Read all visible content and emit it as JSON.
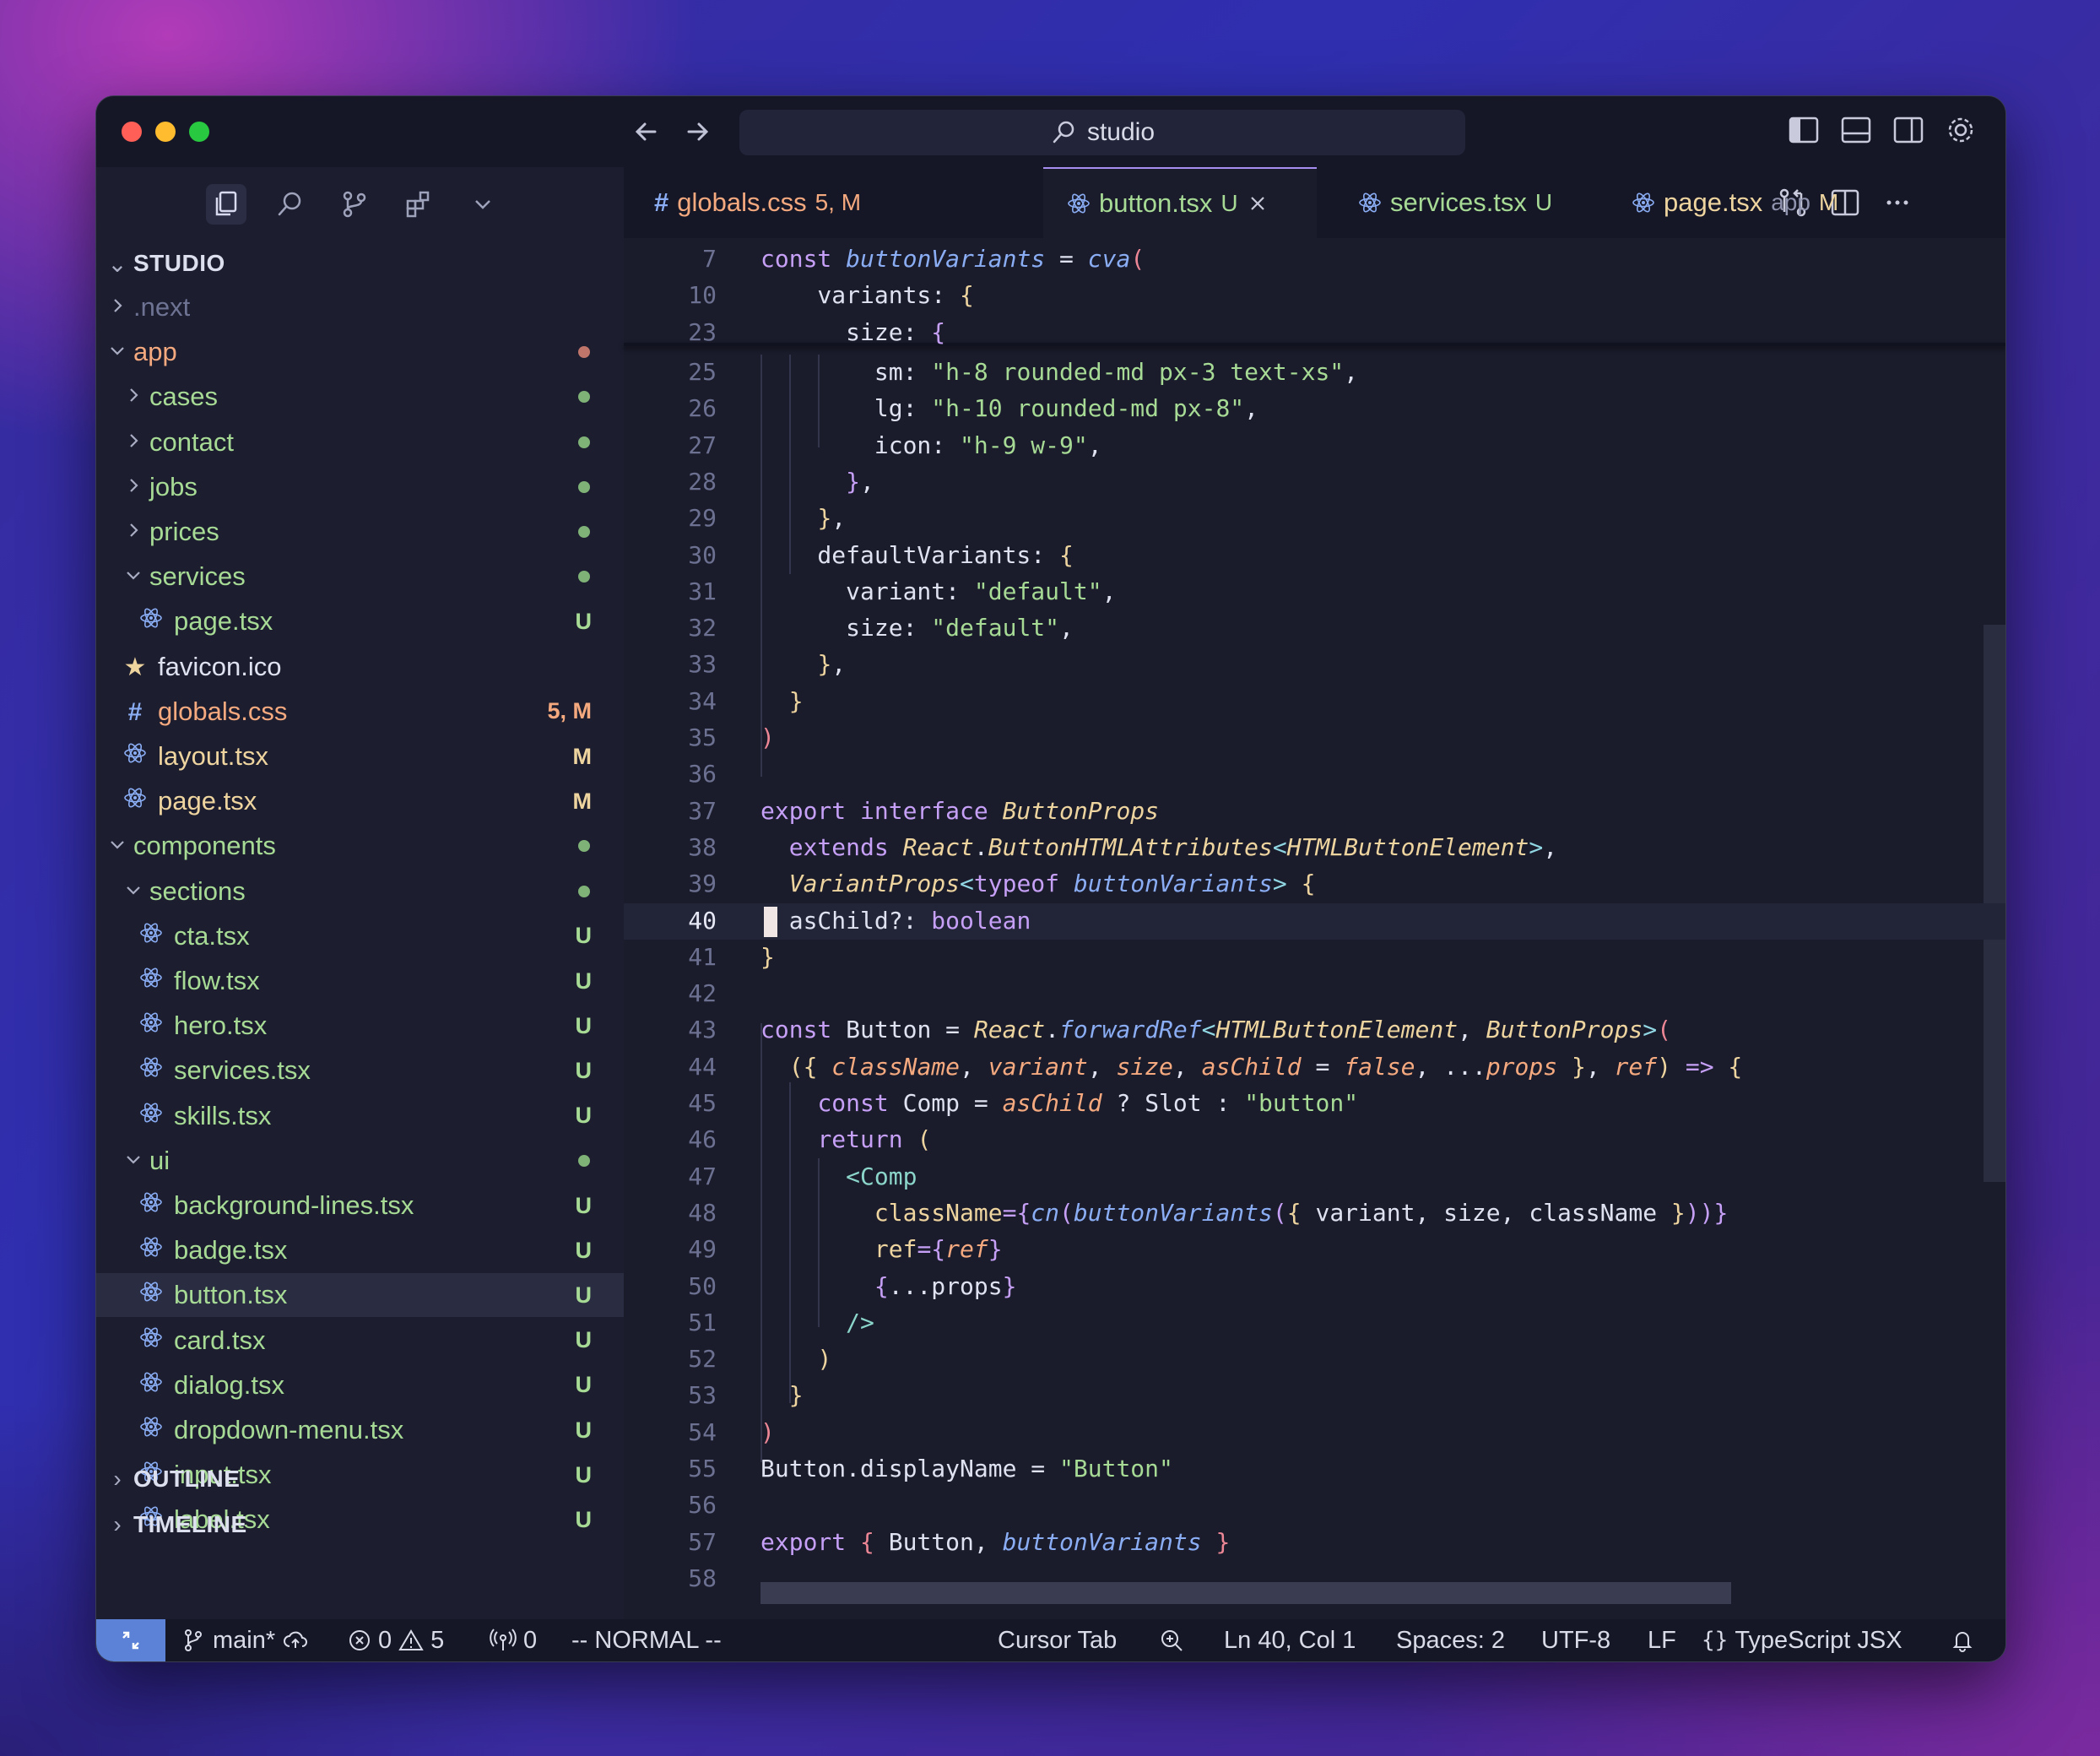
{
  "window": {
    "search": "studio"
  },
  "tabs": [
    {
      "icon": "#",
      "name": "globals.css",
      "status": "5, M",
      "color": "#f5a97f",
      "status_color": "#f5a97f",
      "active": false
    },
    {
      "icon": "react",
      "name": "button.tsx",
      "status": "U",
      "color": "#a6da95",
      "status_color": "#a6da95",
      "active": true
    },
    {
      "icon": "react",
      "name": "services.tsx",
      "status": "U",
      "color": "#a6da95",
      "status_color": "#a6da95",
      "active": false
    },
    {
      "icon": "react",
      "name": "page.tsx",
      "extra": "app",
      "status": "M",
      "color": "#eed49f",
      "status_color": "#eed49f",
      "active": false
    }
  ],
  "explorer": {
    "title": "STUDIO",
    "items": [
      {
        "name": ".next",
        "type": "folder",
        "open": false,
        "depth": 1,
        "color": "#6e7393"
      },
      {
        "name": "app",
        "type": "folder",
        "open": true,
        "depth": 1,
        "color": "#f5a97f",
        "dot": "#c0756a"
      },
      {
        "name": "cases",
        "type": "folder",
        "open": false,
        "depth": 2,
        "color": "#a6da95",
        "dot": "#7fb277"
      },
      {
        "name": "contact",
        "type": "folder",
        "open": false,
        "depth": 2,
        "color": "#a6da95",
        "dot": "#7fb277"
      },
      {
        "name": "jobs",
        "type": "folder",
        "open": false,
        "depth": 2,
        "color": "#a6da95",
        "dot": "#7fb277"
      },
      {
        "name": "prices",
        "type": "folder",
        "open": false,
        "depth": 2,
        "color": "#a6da95",
        "dot": "#7fb277"
      },
      {
        "name": "services",
        "type": "folder",
        "open": true,
        "depth": 2,
        "color": "#a6da95",
        "dot": "#7fb277"
      },
      {
        "name": "page.tsx",
        "type": "react",
        "depth": 3,
        "color": "#a6da95",
        "badge": "U"
      },
      {
        "name": "favicon.ico",
        "type": "star",
        "depth": 2,
        "color": "#dfe2f1"
      },
      {
        "name": "globals.css",
        "type": "hash",
        "depth": 2,
        "color": "#f5a97f",
        "badge": "5, M",
        "badge_color": "#f5a97f"
      },
      {
        "name": "layout.tsx",
        "type": "react",
        "depth": 2,
        "color": "#eed49f",
        "badge": "M",
        "badge_color": "#eed49f"
      },
      {
        "name": "page.tsx",
        "type": "react",
        "depth": 2,
        "color": "#eed49f",
        "badge": "M",
        "badge_color": "#eed49f"
      },
      {
        "name": "components",
        "type": "folder",
        "open": true,
        "depth": 1,
        "color": "#a6da95",
        "dot": "#7fb277"
      },
      {
        "name": "sections",
        "type": "folder",
        "open": true,
        "depth": 2,
        "color": "#a6da95",
        "dot": "#7fb277"
      },
      {
        "name": "cta.tsx",
        "type": "react",
        "depth": 3,
        "color": "#a6da95",
        "badge": "U"
      },
      {
        "name": "flow.tsx",
        "type": "react",
        "depth": 3,
        "color": "#a6da95",
        "badge": "U"
      },
      {
        "name": "hero.tsx",
        "type": "react",
        "depth": 3,
        "color": "#a6da95",
        "badge": "U"
      },
      {
        "name": "services.tsx",
        "type": "react",
        "depth": 3,
        "color": "#a6da95",
        "badge": "U"
      },
      {
        "name": "skills.tsx",
        "type": "react",
        "depth": 3,
        "color": "#a6da95",
        "badge": "U"
      },
      {
        "name": "ui",
        "type": "folder",
        "open": true,
        "depth": 2,
        "color": "#a6da95",
        "dot": "#7fb277"
      },
      {
        "name": "background-lines.tsx",
        "type": "react",
        "depth": 3,
        "color": "#a6da95",
        "badge": "U"
      },
      {
        "name": "badge.tsx",
        "type": "react",
        "depth": 3,
        "color": "#a6da95",
        "badge": "U"
      },
      {
        "name": "button.tsx",
        "type": "react",
        "depth": 3,
        "color": "#a6da95",
        "badge": "U",
        "selected": true
      },
      {
        "name": "card.tsx",
        "type": "react",
        "depth": 3,
        "color": "#a6da95",
        "badge": "U"
      },
      {
        "name": "dialog.tsx",
        "type": "react",
        "depth": 3,
        "color": "#a6da95",
        "badge": "U"
      },
      {
        "name": "dropdown-menu.tsx",
        "type": "react",
        "depth": 3,
        "color": "#a6da95",
        "badge": "U"
      },
      {
        "name": "input.tsx",
        "type": "react",
        "depth": 3,
        "color": "#a6da95",
        "badge": "U"
      },
      {
        "name": "label.tsx",
        "type": "react",
        "depth": 3,
        "color": "#a6da95",
        "badge": "U"
      }
    ],
    "outline": "OUTLINE",
    "timeline": "TIMELINE"
  },
  "editor": {
    "current_line": 40,
    "lines": [
      {
        "n": "7",
        "sticky": true,
        "tokens": [
          [
            "k",
            "const "
          ],
          [
            "f",
            "buttonVariants"
          ],
          [
            "p",
            " = "
          ],
          [
            "f",
            "cva"
          ],
          [
            "br1",
            "("
          ]
        ]
      },
      {
        "n": "10",
        "sticky": true,
        "tokens": [
          [
            "p",
            "    variants: "
          ],
          [
            "br2",
            "{"
          ]
        ]
      },
      {
        "n": "23",
        "sticky": true,
        "tokens": [
          [
            "p",
            "      size: "
          ],
          [
            "k",
            "{"
          ]
        ]
      },
      {
        "n": "25",
        "tokens": [
          [
            "p",
            "        sm: "
          ],
          [
            "s",
            "\"h-8 rounded-md px-3 text-xs\""
          ],
          [
            "p",
            ","
          ]
        ]
      },
      {
        "n": "26",
        "tokens": [
          [
            "p",
            "        lg: "
          ],
          [
            "s",
            "\"h-10 rounded-md px-8\""
          ],
          [
            "p",
            ","
          ]
        ]
      },
      {
        "n": "27",
        "tokens": [
          [
            "p",
            "        icon: "
          ],
          [
            "s",
            "\"h-9 w-9\""
          ],
          [
            "p",
            ","
          ]
        ]
      },
      {
        "n": "28",
        "tokens": [
          [
            "p",
            "      "
          ],
          [
            "k",
            "}"
          ],
          [
            "p",
            ","
          ]
        ]
      },
      {
        "n": "29",
        "tokens": [
          [
            "p",
            "    "
          ],
          [
            "br2",
            "}"
          ],
          [
            "p",
            ","
          ]
        ]
      },
      {
        "n": "30",
        "tokens": [
          [
            "p",
            "    defaultVariants: "
          ],
          [
            "br2",
            "{"
          ]
        ]
      },
      {
        "n": "31",
        "tokens": [
          [
            "p",
            "      variant: "
          ],
          [
            "s",
            "\"default\""
          ],
          [
            "p",
            ","
          ]
        ]
      },
      {
        "n": "32",
        "tokens": [
          [
            "p",
            "      size: "
          ],
          [
            "s",
            "\"default\""
          ],
          [
            "p",
            ","
          ]
        ]
      },
      {
        "n": "33",
        "tokens": [
          [
            "p",
            "    "
          ],
          [
            "br2",
            "}"
          ],
          [
            "p",
            ","
          ]
        ]
      },
      {
        "n": "34",
        "tokens": [
          [
            "p",
            "  "
          ],
          [
            "br2",
            "}"
          ]
        ]
      },
      {
        "n": "35",
        "tokens": [
          [
            "br1",
            ")"
          ]
        ]
      },
      {
        "n": "36",
        "tokens": []
      },
      {
        "n": "37",
        "tokens": [
          [
            "k",
            "export interface "
          ],
          [
            "t",
            "ButtonProps"
          ]
        ]
      },
      {
        "n": "38",
        "tokens": [
          [
            "p",
            "  "
          ],
          [
            "k",
            "extends "
          ],
          [
            "t",
            "React"
          ],
          [
            "p",
            "."
          ],
          [
            "t",
            "ButtonHTMLAttributes"
          ],
          [
            "o",
            "<"
          ],
          [
            "t",
            "HTMLButtonElement"
          ],
          [
            "o",
            ">"
          ],
          [
            "p",
            ","
          ]
        ]
      },
      {
        "n": "39",
        "tokens": [
          [
            "p",
            "  "
          ],
          [
            "t",
            "VariantProps"
          ],
          [
            "o",
            "<"
          ],
          [
            "k",
            "typeof "
          ],
          [
            "f",
            "buttonVariants"
          ],
          [
            "o",
            "> "
          ],
          [
            "br2",
            "{"
          ]
        ]
      },
      {
        "n": "40",
        "tokens": [
          [
            "p",
            "  asChild?: "
          ],
          [
            "k",
            "boolean"
          ]
        ]
      },
      {
        "n": "41",
        "tokens": [
          [
            "br2",
            "}"
          ]
        ]
      },
      {
        "n": "42",
        "tokens": []
      },
      {
        "n": "43",
        "tokens": [
          [
            "k",
            "const "
          ],
          [
            "p",
            "Button = "
          ],
          [
            "t",
            "React"
          ],
          [
            "p",
            "."
          ],
          [
            "f",
            "forwardRef"
          ],
          [
            "o",
            "<"
          ],
          [
            "t",
            "HTMLButtonElement"
          ],
          [
            "p",
            ", "
          ],
          [
            "t",
            "ButtonProps"
          ],
          [
            "o",
            ">"
          ],
          [
            "br1",
            "("
          ]
        ]
      },
      {
        "n": "44",
        "tokens": [
          [
            "p",
            "  "
          ],
          [
            "br2",
            "("
          ],
          [
            "br2",
            "{ "
          ],
          [
            "pi",
            "className"
          ],
          [
            "p",
            ", "
          ],
          [
            "pi",
            "variant"
          ],
          [
            "p",
            ", "
          ],
          [
            "pi",
            "size"
          ],
          [
            "p",
            ", "
          ],
          [
            "pi",
            "asChild"
          ],
          [
            "p",
            " = "
          ],
          [
            "pi",
            "false"
          ],
          [
            "p",
            ", ..."
          ],
          [
            "pi",
            "props"
          ],
          [
            "p",
            " "
          ],
          [
            "br2",
            "}"
          ],
          [
            "p",
            ", "
          ],
          [
            "pi",
            "ref"
          ],
          [
            "br2",
            ")"
          ],
          [
            "k",
            " => "
          ],
          [
            "br2",
            "{"
          ]
        ]
      },
      {
        "n": "45",
        "tokens": [
          [
            "p",
            "    "
          ],
          [
            "k",
            "const "
          ],
          [
            "p",
            "Comp = "
          ],
          [
            "pi",
            "asChild"
          ],
          [
            "p",
            " ? Slot : "
          ],
          [
            "s",
            "\"button\""
          ]
        ]
      },
      {
        "n": "46",
        "tokens": [
          [
            "p",
            "    "
          ],
          [
            "k",
            "return "
          ],
          [
            "br2",
            "("
          ]
        ]
      },
      {
        "n": "47",
        "tokens": [
          [
            "p",
            "      "
          ],
          [
            "ct",
            "<Comp"
          ]
        ]
      },
      {
        "n": "48",
        "tokens": [
          [
            "p",
            "        "
          ],
          [
            "br2",
            "className"
          ],
          [
            "k",
            "="
          ],
          [
            "k",
            "{"
          ],
          [
            "f",
            "cn"
          ],
          [
            "k",
            "("
          ],
          [
            "f",
            "buttonVariants"
          ],
          [
            "k",
            "("
          ],
          [
            "br2",
            "{ "
          ],
          [
            "p",
            "variant, size, className "
          ],
          [
            "br2",
            "}"
          ],
          [
            "k",
            ")"
          ],
          [
            "k",
            ")"
          ],
          [
            "k",
            "}"
          ]
        ]
      },
      {
        "n": "49",
        "tokens": [
          [
            "p",
            "        "
          ],
          [
            "br2",
            "ref"
          ],
          [
            "k",
            "="
          ],
          [
            "k",
            "{"
          ],
          [
            "pi",
            "ref"
          ],
          [
            "k",
            "}"
          ]
        ]
      },
      {
        "n": "50",
        "tokens": [
          [
            "p",
            "        "
          ],
          [
            "k",
            "{"
          ],
          [
            "p",
            "..."
          ],
          [
            "p",
            "props"
          ],
          [
            "k",
            "}"
          ]
        ]
      },
      {
        "n": "51",
        "tokens": [
          [
            "p",
            "      "
          ],
          [
            "ct",
            "/>"
          ]
        ]
      },
      {
        "n": "52",
        "tokens": [
          [
            "p",
            "    "
          ],
          [
            "br2",
            ")"
          ]
        ]
      },
      {
        "n": "53",
        "tokens": [
          [
            "p",
            "  "
          ],
          [
            "br2",
            "}"
          ]
        ]
      },
      {
        "n": "54",
        "tokens": [
          [
            "br1",
            ")"
          ]
        ]
      },
      {
        "n": "55",
        "tokens": [
          [
            "p",
            "Button.displayName = "
          ],
          [
            "s",
            "\"Button\""
          ]
        ]
      },
      {
        "n": "56",
        "tokens": []
      },
      {
        "n": "57",
        "tokens": [
          [
            "k",
            "export "
          ],
          [
            "br1",
            "{ "
          ],
          [
            "p",
            "Button, "
          ],
          [
            "f",
            "buttonVariants"
          ],
          [
            "br1",
            " }"
          ]
        ]
      },
      {
        "n": "58",
        "tokens": []
      }
    ]
  },
  "statusbar": {
    "branch": "main*",
    "errors": "0",
    "warnings": "5",
    "ports": "0",
    "mode": "-- NORMAL --",
    "cursor_tab": "Cursor Tab",
    "position": "Ln 40, Col 1",
    "spaces": "Spaces: 2",
    "encoding": "UTF-8",
    "eol": "LF",
    "language": "TypeScript JSX"
  }
}
